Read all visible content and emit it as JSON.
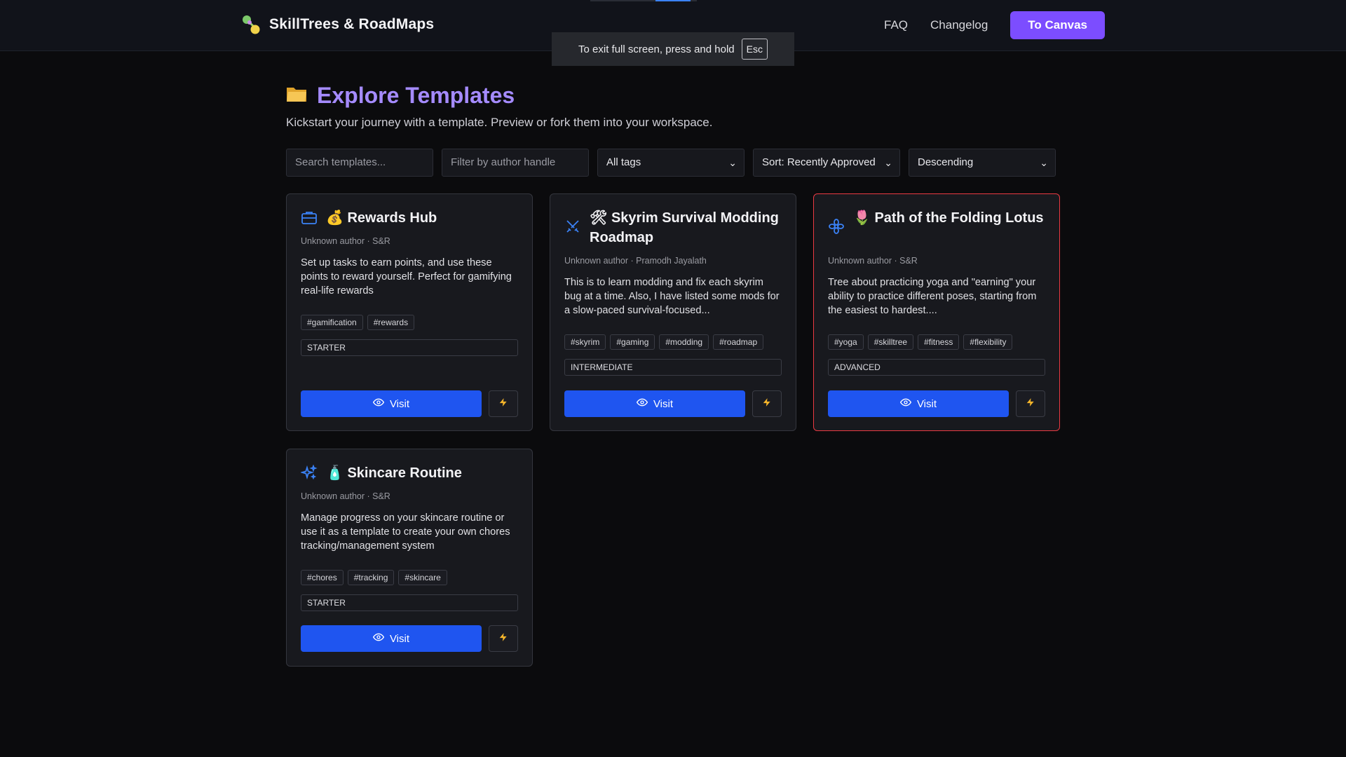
{
  "header": {
    "brand": "SkillTrees & RoadMaps",
    "nav": {
      "faq": "FAQ",
      "changelog": "Changelog",
      "cta": "To Canvas"
    },
    "fullscreen_notice": {
      "text": "To exit full screen, press and hold",
      "key": "Esc"
    }
  },
  "page": {
    "title": "Explore Templates",
    "subtitle": "Kickstart your journey with a template. Preview or fork them into your workspace."
  },
  "filters": {
    "search_placeholder": "Search templates...",
    "author_placeholder": "Filter by author handle",
    "tags_selected": "All tags",
    "sort_selected": "Sort: Recently Approved",
    "order_selected": "Descending"
  },
  "cards": [
    {
      "icon": "briefcase-icon",
      "title": "💰 Rewards Hub",
      "meta": "Unknown author · S&R",
      "description": "Set up tasks to earn points, and use these points to reward yourself. Perfect for gamifying real-life rewards",
      "tags": [
        "#gamification",
        "#rewards"
      ],
      "level": "STARTER",
      "visit_label": "Visit",
      "highlighted": false
    },
    {
      "icon": "swords-icon",
      "title": "🛠 Skyrim Survival Modding Roadmap",
      "meta": "Unknown author · Pramodh Jayalath",
      "description": "This is to learn modding and fix each skyrim bug at a time. Also, I have listed some mods for a slow-paced survival-focused...",
      "tags": [
        "#skyrim",
        "#gaming",
        "#modding",
        "#roadmap"
      ],
      "level": "INTERMEDIATE",
      "visit_label": "Visit",
      "highlighted": false
    },
    {
      "icon": "flower-icon",
      "title": "🌷 Path of the Folding Lotus",
      "meta": "Unknown author · S&R",
      "description": "Tree about practicing yoga and \"earning\" your ability to practice different poses, starting from the easiest to hardest....",
      "tags": [
        "#yoga",
        "#skilltree",
        "#fitness",
        "#flexibility"
      ],
      "level": "ADVANCED",
      "visit_label": "Visit",
      "highlighted": true
    },
    {
      "icon": "sparkles-icon",
      "title": "🧴 Skincare Routine",
      "meta": "Unknown author · S&R",
      "description": "Manage progress on your skincare routine or use it as a template to create your own chores tracking/management system",
      "tags": [
        "#chores",
        "#tracking",
        "#skincare"
      ],
      "level": "STARTER",
      "visit_label": "Visit",
      "highlighted": false
    }
  ],
  "colors": {
    "accent": "#7c4dff",
    "title": "#a58bff",
    "visit": "#1f55f0",
    "highlight_border": "#ea3a42",
    "icon_blue": "#3b82f6"
  }
}
